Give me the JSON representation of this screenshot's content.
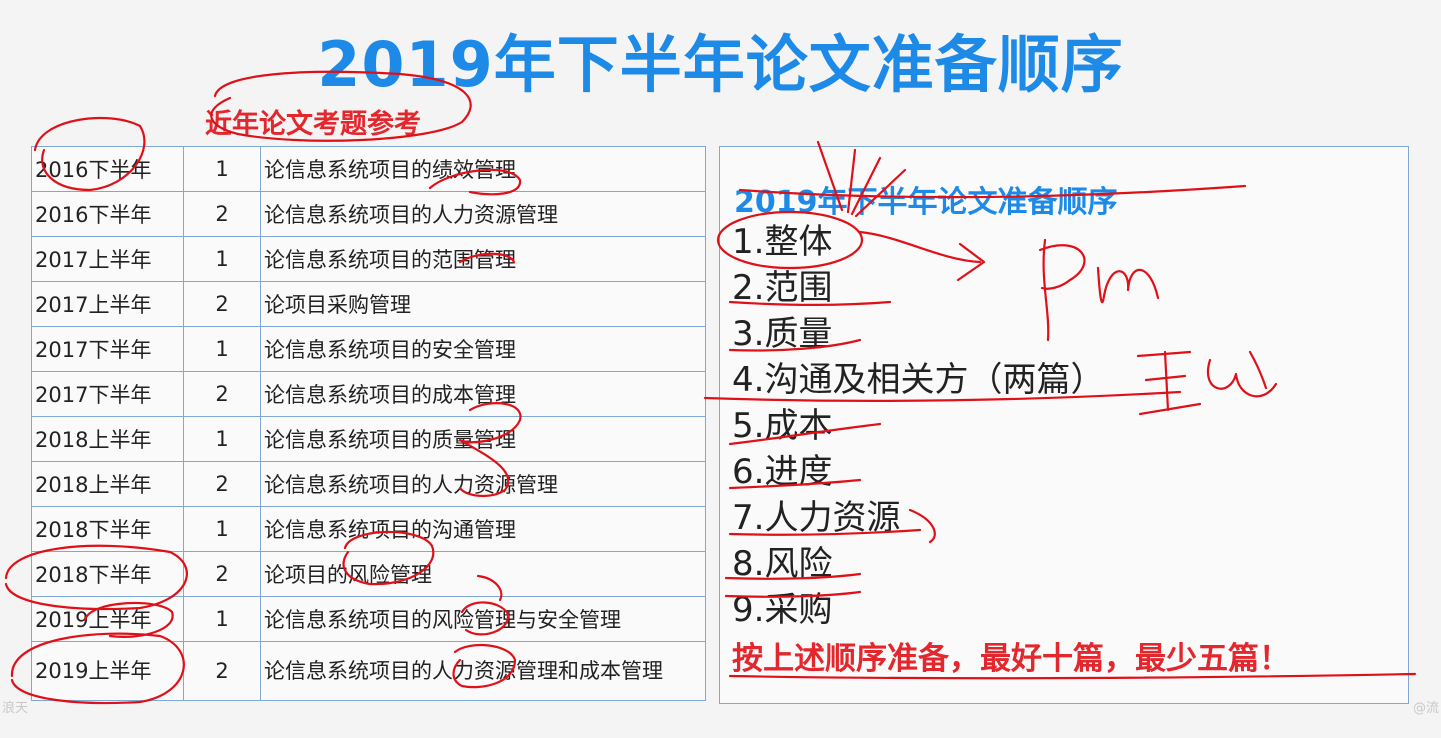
{
  "page": {
    "title": "2019年下半年论文准备顺序",
    "subtitle": "近年论文考题参考"
  },
  "table": {
    "rows": [
      {
        "term": "2016下半年",
        "no": "1",
        "topic": "论信息系统项目的绩效管理"
      },
      {
        "term": "2016下半年",
        "no": "2",
        "topic": "论信息系统项目的人力资源管理"
      },
      {
        "term": "2017上半年",
        "no": "1",
        "topic": "论信息系统项目的范围管理"
      },
      {
        "term": "2017上半年",
        "no": "2",
        "topic": "论项目采购管理"
      },
      {
        "term": "2017下半年",
        "no": "1",
        "topic": "论信息系统项目的安全管理"
      },
      {
        "term": "2017下半年",
        "no": "2",
        "topic": "论信息系统项目的成本管理"
      },
      {
        "term": "2018上半年",
        "no": "1",
        "topic": "论信息系统项目的质量管理"
      },
      {
        "term": "2018上半年",
        "no": "2",
        "topic": " 论信息系统项目的人力资源管理"
      },
      {
        "term": "2018下半年",
        "no": "1",
        "topic": "论信息系统项目的沟通管理"
      },
      {
        "term": "2018下半年",
        "no": "2",
        "topic": "论项目的风险管理"
      },
      {
        "term": "2019上半年",
        "no": "1",
        "topic": "论信息系统项目的风险管理与安全管理"
      },
      {
        "term": "2019上半年",
        "no": "2",
        "topic": "论信息系统项目的人力资源管理和成本管理"
      }
    ]
  },
  "order_panel": {
    "title": "2019年下半年论文准备顺序",
    "items": [
      "1.整体",
      "2.范围",
      "3.质量",
      "4.沟通及相关方（两篇）",
      "5.成本",
      "6.进度",
      "7.人力资源",
      "8.风险",
      "9.采购"
    ],
    "conclusion": "按上述顺序准备，最好十篇，最少五篇！"
  },
  "watermarks": {
    "left": "浪天",
    "right": "@流"
  },
  "annotations": {
    "handwriting": [
      "PM",
      "王solo"
    ]
  },
  "colors": {
    "title_blue": "#1d8ae8",
    "accent_red": "#e4262d",
    "border_blue": "#7fa9d4",
    "ink_red": "#e01018"
  }
}
